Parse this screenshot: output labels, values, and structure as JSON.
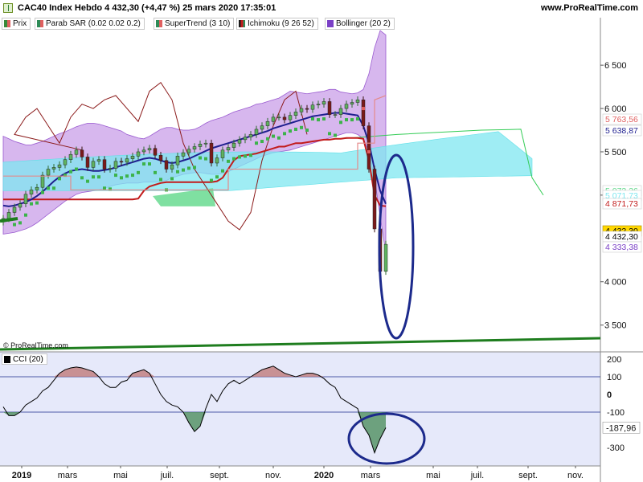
{
  "header": {
    "title": "CAC40 Index Hebdo 4 432,30 (+4,47 %) 25 mars 2020 17:35:01",
    "site": "www.ProRealTime.com"
  },
  "legend": [
    {
      "label": "Prix",
      "color": "#3a8a3a"
    },
    {
      "label": "Parab SAR (0.02 0.02 0.2)",
      "color": "#2e8b57"
    },
    {
      "label": "SuperTrend (3 10)",
      "color": "#e06060"
    },
    {
      "label": "Ichimoku (9 26 52)",
      "color": "#1a1a1a"
    },
    {
      "label": "Bollinger (20 2)",
      "color": "#7a3fc6"
    }
  ],
  "watermark": "© ProRealTime.com",
  "cci_legend": {
    "label": "CCI (20)",
    "color": "#000000"
  },
  "colors": {
    "bollinger_fill": "#b77be0",
    "cloud_cyan": "#7fe7f0",
    "cloud_green": "#5fd88a",
    "candle_up": "#5fb35f",
    "candle_down": "#7a1a1a",
    "tenkan": "#1f1f8f",
    "kijun": "#c21b1b",
    "chikou": "#8b1a1a",
    "trendline": "#1e7d1e",
    "ellipse": "#1c2a8c",
    "cci_line": "#000000"
  },
  "chart_data": [
    {
      "type": "line",
      "title": "CAC40 Index Hebdo",
      "ylim": [
        3200,
        6900
      ],
      "y_ticks": [
        "6 500",
        "6 000",
        "5 500",
        "5 000",
        "4 000",
        "3 500"
      ],
      "x_tick_labels": [
        "2019",
        "mars",
        "mai",
        "juil.",
        "sept.",
        "nov.",
        "2020",
        "mars",
        "mai",
        "juil.",
        "sept.",
        "nov."
      ],
      "price_labels": [
        {
          "text": "5 763,56",
          "color": "#e06060"
        },
        {
          "text": "5 638,87",
          "color": "#1f1f8f"
        },
        {
          "text": "5 073,36",
          "color": "#5fd88a"
        },
        {
          "text": "5 071,73",
          "color": "#7fe7f0"
        },
        {
          "text": "4 871,73",
          "color": "#c21b1b"
        },
        {
          "text": "4 432,30",
          "color": "#000000",
          "bg": "#ffd700"
        },
        {
          "text": "4 432,30",
          "color": "#000000"
        },
        {
          "text": "4 333,38",
          "color": "#7a3fc6"
        }
      ],
      "close": [
        4730,
        4800,
        4860,
        4900,
        5010,
        5060,
        5090,
        5230,
        5300,
        5320,
        5350,
        5410,
        5470,
        5520,
        5440,
        5320,
        5390,
        5410,
        5300,
        5310,
        5390,
        5380,
        5420,
        5450,
        5500,
        5520,
        5540,
        5460,
        5400,
        5300,
        5350,
        5450,
        5490,
        5530,
        5560,
        5590,
        5600,
        5370,
        5430,
        5520,
        5550,
        5600,
        5640,
        5670,
        5700,
        5760,
        5800,
        5850,
        5900,
        5900,
        5870,
        5920,
        5960,
        6000,
        5990,
        6040,
        6050,
        6080,
        5930,
        5930,
        6000,
        6050,
        6070,
        6100,
        5800,
        5300,
        4610,
        4120,
        4432.3
      ],
      "bollinger_upper": [
        5680,
        5650,
        5620,
        5600,
        5580,
        5580,
        5600,
        5620,
        5650,
        5680,
        5710,
        5730,
        5760,
        5790,
        5810,
        5830,
        5830,
        5820,
        5800,
        5780,
        5760,
        5740,
        5700,
        5680,
        5660,
        5650,
        5680,
        5720,
        5760,
        5780,
        5780,
        5760,
        5750,
        5750,
        5760,
        5790,
        5830,
        5860,
        5880,
        5900,
        5930,
        5960,
        5980,
        6000,
        6020,
        6050,
        6060,
        6080,
        6100,
        6120,
        6160,
        6200,
        6190,
        6180,
        6170,
        6180,
        6190,
        6200,
        6220,
        6220,
        6190,
        6180,
        6170,
        6180,
        6220,
        6400,
        6700,
        6900,
        6850
      ],
      "bollinger_lower": [
        4550,
        4560,
        4570,
        4590,
        4610,
        4640,
        4680,
        4730,
        4780,
        4830,
        4880,
        4930,
        4970,
        5010,
        5030,
        5040,
        5050,
        5060,
        5080,
        5100,
        5120,
        5130,
        5140,
        5140,
        5140,
        5150,
        5150,
        5150,
        5160,
        5170,
        5200,
        5220,
        5240,
        5250,
        5260,
        5260,
        5250,
        5240,
        5240,
        5250,
        5270,
        5300,
        5330,
        5360,
        5390,
        5420,
        5450,
        5470,
        5490,
        5500,
        5510,
        5520,
        5540,
        5560,
        5580,
        5600,
        5620,
        5640,
        5660,
        5680,
        5700,
        5720,
        5720,
        5700,
        5650,
        5500,
        5200,
        4750,
        4333.38
      ],
      "tenkan": [
        4880,
        4870,
        4880,
        4900,
        4920,
        4950,
        4990,
        5040,
        5100,
        5160,
        5210,
        5250,
        5280,
        5290,
        5300,
        5290,
        5280,
        5280,
        5290,
        5300,
        5320,
        5340,
        5360,
        5380,
        5400,
        5420,
        5430,
        5420,
        5400,
        5380,
        5370,
        5380,
        5400,
        5420,
        5450,
        5480,
        5510,
        5540,
        5560,
        5580,
        5600,
        5620,
        5640,
        5660,
        5680,
        5700,
        5720,
        5740,
        5770,
        5790,
        5810,
        5830,
        5850,
        5870,
        5890,
        5910,
        5920,
        5930,
        5940,
        5950,
        5950,
        5940,
        5930,
        5920,
        5800,
        5600,
        5300,
        5050,
        4900
      ],
      "kijun": [
        4950,
        4950,
        4950,
        4950,
        4950,
        4950,
        4950,
        4950,
        4950,
        4950,
        4950,
        4950,
        4950,
        4950,
        4950,
        4950,
        4950,
        4950,
        4950,
        4950,
        4950,
        4950,
        4950,
        4950,
        4960,
        5050,
        5100,
        5120,
        5140,
        5150,
        5150,
        5150,
        5150,
        5150,
        5150,
        5150,
        5150,
        5150,
        5160,
        5200,
        5300,
        5400,
        5450,
        5460,
        5470,
        5480,
        5500,
        5520,
        5540,
        5560,
        5560,
        5580,
        5600,
        5600,
        5610,
        5620,
        5630,
        5640,
        5640,
        5650,
        5650,
        5660,
        5660,
        5660,
        5650,
        5400,
        5000,
        4880,
        4871.73
      ],
      "cci": [
        -70,
        -120,
        -120,
        -100,
        -60,
        -40,
        -20,
        20,
        40,
        80,
        120,
        140,
        150,
        155,
        150,
        140,
        130,
        100,
        60,
        40,
        40,
        70,
        80,
        120,
        130,
        140,
        120,
        60,
        0,
        -40,
        -60,
        -70,
        -100,
        -160,
        -210,
        -180,
        -80,
        0,
        -40,
        20,
        60,
        80,
        60,
        80,
        100,
        120,
        140,
        150,
        160,
        140,
        120,
        110,
        100,
        110,
        120,
        120,
        110,
        90,
        60,
        40,
        -20,
        -40,
        -60,
        -80,
        -180,
        -230,
        -330,
        -250,
        -187.96
      ],
      "cci_ticks": [
        "200",
        "100",
        "0",
        "-100",
        "-300"
      ],
      "cci_value_label": "-187,96"
    }
  ]
}
